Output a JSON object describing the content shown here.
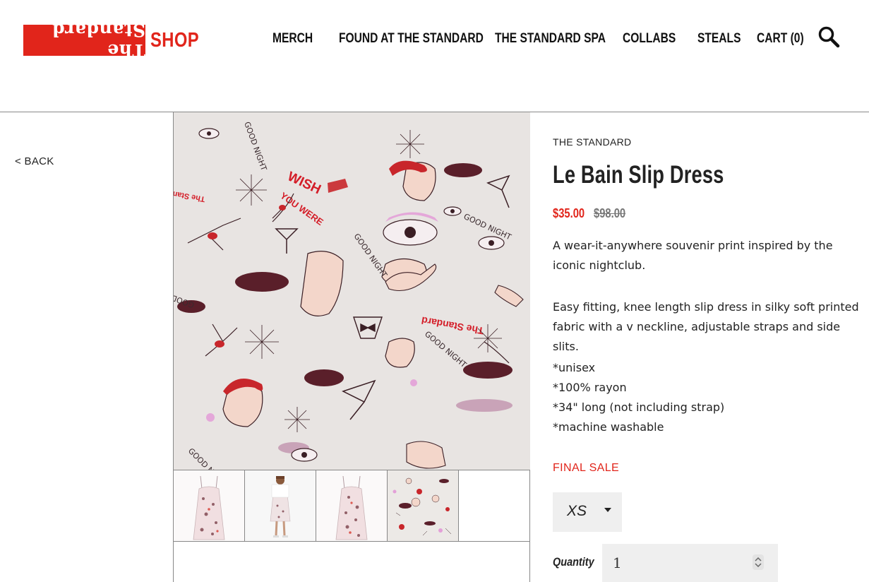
{
  "header": {
    "logo": {
      "wordmark": "The Standard",
      "suffix": "SHOP",
      "brand_color": "#e1251b"
    },
    "nav": [
      {
        "label": "MERCH"
      },
      {
        "label": "FOUND AT THE STANDARD"
      },
      {
        "label": "THE STANDARD SPA"
      },
      {
        "label": "COLLABS"
      },
      {
        "label": "STEALS"
      },
      {
        "label": "CART (0)"
      }
    ],
    "search_icon": "search-icon"
  },
  "back_link": "< BACK",
  "product": {
    "brand": "THE STANDARD",
    "title": "Le Bain Slip Dress",
    "sale_price": "$35.00",
    "original_price": "$98.00",
    "description": [
      "A wear-it-anywhere souvenir print inspired by the iconic nightclub.",
      "Easy fitting, knee length slip dress in silky soft printed fabric with a v neckline, adjustable straps and side slits."
    ],
    "details": [
      "*unisex",
      "*100% rayon",
      "*34\" long (not including strap)",
      "*machine washable"
    ],
    "final_sale": "FINAL SALE",
    "size": {
      "selected": "XS"
    },
    "quantity": {
      "label": "Quantity",
      "value": "1"
    },
    "colors": {
      "accent": "#e1251b",
      "muted": "#777777",
      "field_bg": "#efefef"
    }
  },
  "gallery": {
    "main_image_print_text": [
      "WISH YOU WERE HERE",
      "GOOD NIGHT",
      "The Standard"
    ],
    "thumbnails": [
      {
        "alt": "dress-flat-front"
      },
      {
        "alt": "dress-on-model"
      },
      {
        "alt": "dress-flat-back"
      },
      {
        "alt": "print-detail"
      }
    ]
  }
}
